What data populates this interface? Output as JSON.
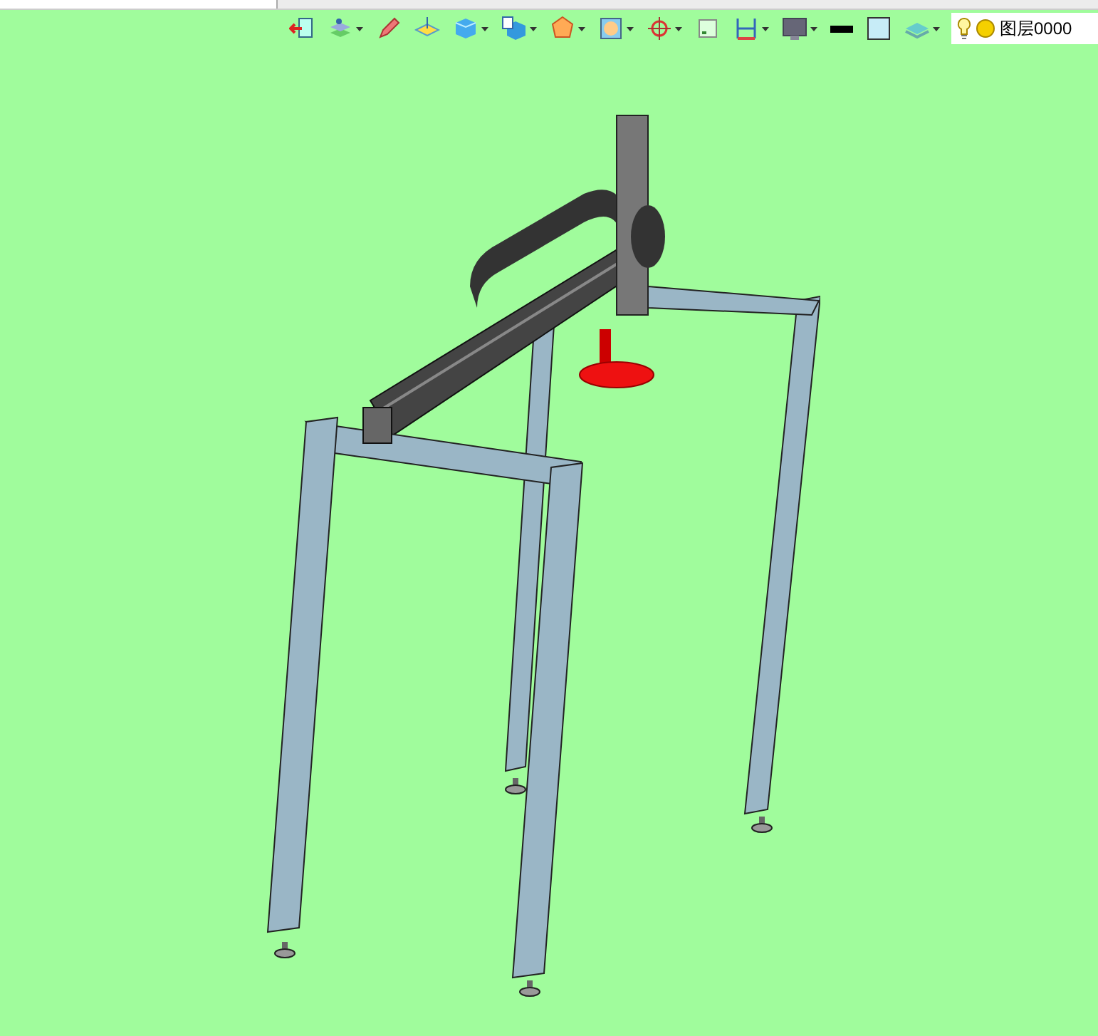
{
  "toolbar": {
    "buttons": [
      {
        "kind": "exit",
        "dropdown": false
      },
      {
        "kind": "layers",
        "dropdown": true
      },
      {
        "kind": "pencil",
        "dropdown": false
      },
      {
        "kind": "plane",
        "dropdown": false
      },
      {
        "kind": "cube",
        "dropdown": true
      },
      {
        "kind": "cubedoc",
        "dropdown": true
      },
      {
        "kind": "polyhedron",
        "dropdown": true
      },
      {
        "kind": "frame",
        "dropdown": true
      },
      {
        "kind": "target",
        "dropdown": true
      },
      {
        "kind": "square",
        "dropdown": false
      },
      {
        "kind": "dimension",
        "dropdown": true
      },
      {
        "kind": "monitor",
        "dropdown": true
      },
      {
        "kind": "line",
        "dropdown": false
      },
      {
        "kind": "fill",
        "dropdown": false
      },
      {
        "kind": "stack",
        "dropdown": true
      }
    ]
  },
  "layer_selector": {
    "value": "图层0000",
    "visible": true
  }
}
